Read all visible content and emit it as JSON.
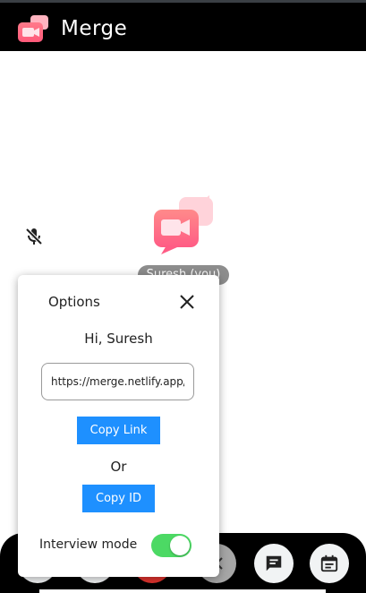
{
  "app": {
    "title": "Merge"
  },
  "participant": {
    "name": "Suresh (you)"
  },
  "options_popup": {
    "title": "Options",
    "greeting": "Hi, Suresh",
    "link_value": "https://merge.netlify.app/",
    "copy_link_label": "Copy Link",
    "or_label": "Or",
    "copy_id_label": "Copy ID",
    "interview_mode_label": "Interview mode",
    "interview_mode_on": true
  },
  "colors": {
    "accent": "#1e90ff",
    "toggle_on": "#4cd964",
    "end_call": "#e0332e"
  },
  "controls": [
    "mic-icon",
    "camera-icon",
    "end-call-icon",
    "close-icon",
    "chat-icon",
    "calendar-icon"
  ]
}
